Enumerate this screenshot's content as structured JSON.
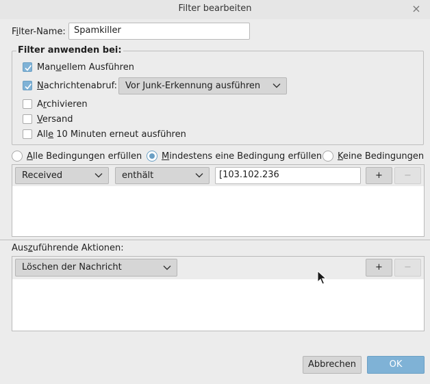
{
  "dialog": {
    "title": "Filter bearbeiten",
    "close_glyph": "×"
  },
  "filter_name": {
    "label_prefix": "F",
    "label_underlined": "i",
    "label_suffix": "lter-Name:",
    "value": "Spamkiller"
  },
  "apply_group": {
    "title": "Filter anwenden bei:",
    "options": [
      {
        "pre": "Man",
        "u": "u",
        "post": "ellem Ausführen",
        "checked": true
      },
      {
        "pre": "",
        "u": "N",
        "post": "achrichtenabruf:",
        "checked": true
      },
      {
        "pre": "A",
        "u": "r",
        "post": "chivieren",
        "checked": false
      },
      {
        "pre": "",
        "u": "V",
        "post": "ersand",
        "checked": false
      },
      {
        "pre": "All",
        "u": "e",
        "post": " 10 Minuten erneut ausführen",
        "checked": false
      }
    ],
    "junk_dropdown_value": "Vor Junk-Erkennung ausführen"
  },
  "match_mode": {
    "options": [
      {
        "u": "A",
        "post": "lle Bedingungen erfüllen",
        "selected": false
      },
      {
        "u": "M",
        "post": "indestens eine Bedingung erfüllen",
        "selected": true
      },
      {
        "u": "K",
        "post": "eine Bedingungen",
        "selected": false
      }
    ]
  },
  "condition": {
    "field": "Received",
    "operator": "enthält",
    "value": "[103.102.236",
    "add_label": "+",
    "remove_label": "−"
  },
  "actions": {
    "label_pre": "Aus",
    "label_u": "z",
    "label_post": "uführende Aktionen:",
    "action": "Löschen der Nachricht",
    "add_label": "+",
    "remove_label": "−"
  },
  "footer": {
    "cancel_label": "Abbrechen",
    "ok_label": "OK"
  },
  "colors": {
    "accent": "#7fb2d6",
    "background": "#ececec"
  }
}
